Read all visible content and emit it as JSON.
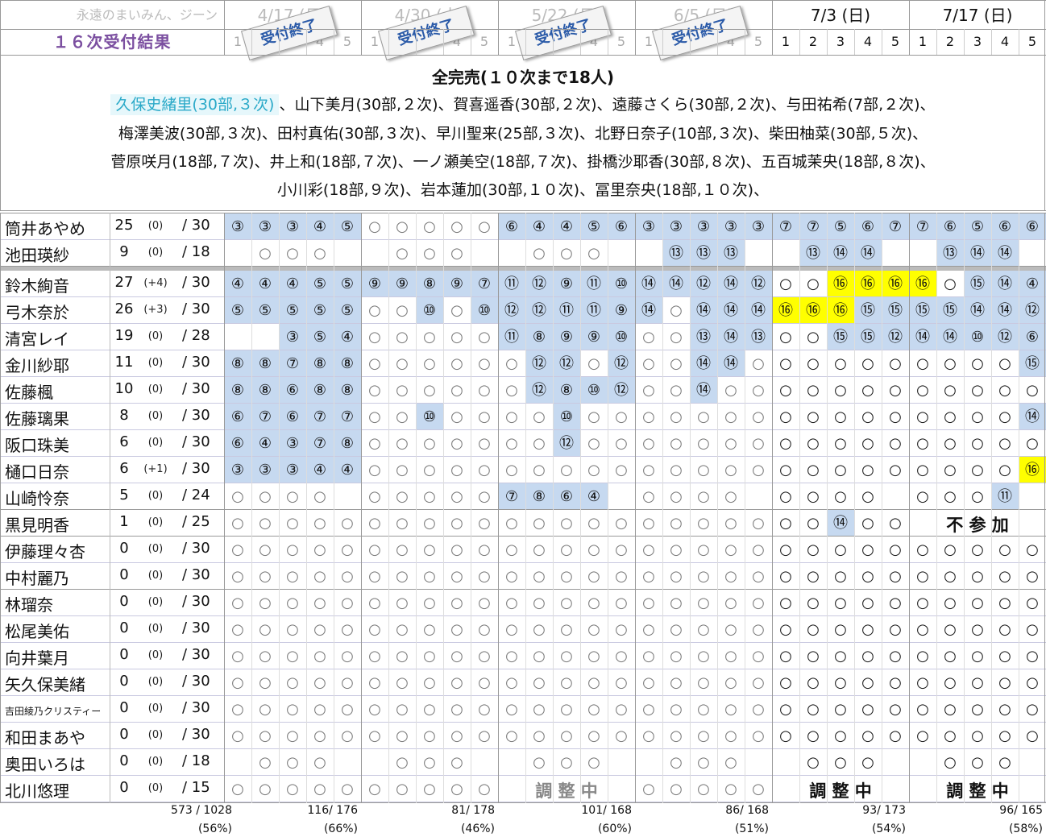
{
  "header": {
    "site_title": "永遠のまいみん、ジーン",
    "result_title": "１６次受付結果",
    "dates": [
      {
        "label": "4/17 (日)",
        "past": true
      },
      {
        "label": "4/30 (土)",
        "past": true
      },
      {
        "label": "5/22 (日)",
        "past": true
      },
      {
        "label": "6/5 (日)",
        "past": true
      },
      {
        "label": "7/3 (日)",
        "past": false
      },
      {
        "label": "7/17 (日)",
        "past": false
      }
    ],
    "slots": [
      "1",
      "2",
      "3",
      "4",
      "5"
    ],
    "closed_stamp": "受付終了"
  },
  "soldout": {
    "title": "全完売(１０次まで18人)",
    "highlight": "久保史緒里(30部,３次)",
    "lines": [
      "、山下美月(30部,２次)、賀喜遥香(30部,２次)、遠藤さくら(30部,２次)、与田祐希(7部,２次)、",
      "梅澤美波(30部,３次)、田村真佑(30部,３次)、早川聖来(25部,３次)、北野日奈子(10部,３次)、柴田柚菜(30部,５次)、",
      "菅原咲月(18部,７次)、井上和(18部,７次)、一ノ瀬美空(18部,７次)、掛橋沙耶香(30部,８次)、五百城茉央(18部,８次)、",
      "小川彩(18部,９次)、岩本蓮加(30部,１０次)、冨里奈央(18部,１０次)、"
    ]
  },
  "members": [
    {
      "name": "筒井あやめ",
      "count": "25",
      "delta": "(0)",
      "total": "/ 30",
      "cells": [
        "b③",
        "b③",
        "b③",
        "b④",
        "b⑤",
        "○",
        "○",
        "○",
        "○",
        "○",
        "b⑥",
        "b④",
        "b④",
        "b⑤",
        "b⑥",
        "b③",
        "b③",
        "b③",
        "b③",
        "b③",
        "b⑦",
        "b⑦",
        "b⑤",
        "b⑥",
        "b⑦",
        "b⑦",
        "b⑥",
        "b⑤",
        "b⑥",
        "b⑥"
      ]
    },
    {
      "name": "池田瑛紗",
      "count": "9",
      "delta": "(0)",
      "total": "/ 18",
      "cells": [
        "",
        "○",
        "○",
        "○",
        "",
        "",
        "○",
        "○",
        "○",
        "",
        "",
        "○",
        "○",
        "○",
        "",
        "",
        "b⑬",
        "b⑬",
        "b⑬",
        "",
        "",
        "b⑬",
        "b⑭",
        "b⑭",
        "",
        "",
        "b⑬",
        "b⑭",
        "b⑭",
        ""
      ]
    },
    {
      "name": "鈴木絢音",
      "count": "27",
      "delta": "(+4)",
      "total": "/ 30",
      "cells": [
        "b④",
        "b④",
        "b④",
        "b⑤",
        "b⑤",
        "b⑨",
        "b⑨",
        "b⑧",
        "b⑨",
        "b⑦",
        "b⑪",
        "b⑫",
        "b⑨",
        "b⑪",
        "b⑩",
        "b⑭",
        "b⑭",
        "b⑫",
        "b⑭",
        "b⑫",
        "○",
        "○",
        "y⑯",
        "y⑯",
        "y⑯",
        "y⑯",
        "○",
        "b⑮",
        "b⑭",
        "b④"
      ]
    },
    {
      "name": "弓木奈於",
      "count": "26",
      "delta": "(+3)",
      "total": "/ 30",
      "cells": [
        "b⑤",
        "b⑤",
        "b⑤",
        "b⑤",
        "b⑤",
        "○",
        "○",
        "b⑩",
        "○",
        "b⑩",
        "b⑫",
        "b⑫",
        "b⑪",
        "b⑪",
        "b⑨",
        "b⑭",
        "○",
        "b⑭",
        "b⑭",
        "b⑭",
        "y⑯",
        "y⑯",
        "y⑯",
        "b⑮",
        "b⑮",
        "b⑮",
        "b⑮",
        "b⑭",
        "b⑭",
        "b⑫"
      ]
    },
    {
      "name": "清宮レイ",
      "count": "19",
      "delta": "(0)",
      "total": "/ 28",
      "cells": [
        "",
        "",
        "b③",
        "b⑤",
        "b④",
        "○",
        "○",
        "○",
        "○",
        "○",
        "b⑪",
        "b⑧",
        "b⑨",
        "b⑨",
        "b⑩",
        "○",
        "○",
        "b⑬",
        "b⑭",
        "b⑬",
        "○",
        "○",
        "b⑮",
        "b⑮",
        "b⑫",
        "b⑭",
        "b⑭",
        "b⑩",
        "b⑫",
        "b⑥"
      ]
    },
    {
      "name": "金川紗耶",
      "count": "11",
      "delta": "(0)",
      "total": "/ 30",
      "cells": [
        "b⑧",
        "b⑧",
        "b⑦",
        "b⑧",
        "b⑧",
        "○",
        "○",
        "○",
        "○",
        "○",
        "○",
        "b⑫",
        "b⑫",
        "○",
        "b⑫",
        "○",
        "○",
        "b⑭",
        "b⑭",
        "○",
        "○",
        "○",
        "○",
        "○",
        "○",
        "○",
        "○",
        "○",
        "○",
        "b⑮"
      ]
    },
    {
      "name": "佐藤楓",
      "count": "10",
      "delta": "(0)",
      "total": "/ 30",
      "cells": [
        "b⑧",
        "b⑧",
        "b⑥",
        "b⑧",
        "b⑧",
        "○",
        "○",
        "○",
        "○",
        "○",
        "○",
        "b⑫",
        "b⑧",
        "b⑩",
        "b⑫",
        "○",
        "○",
        "b⑭",
        "○",
        "○",
        "○",
        "○",
        "○",
        "○",
        "○",
        "○",
        "○",
        "○",
        "○",
        "○"
      ]
    },
    {
      "name": "佐藤璃果",
      "count": "8",
      "delta": "(0)",
      "total": "/ 30",
      "cells": [
        "b⑥",
        "b⑦",
        "b⑥",
        "b⑦",
        "b⑦",
        "○",
        "○",
        "b⑩",
        "○",
        "○",
        "○",
        "○",
        "b⑩",
        "○",
        "○",
        "○",
        "○",
        "○",
        "○",
        "○",
        "○",
        "○",
        "○",
        "○",
        "○",
        "○",
        "○",
        "○",
        "○",
        "b⑭"
      ]
    },
    {
      "name": "阪口珠美",
      "count": "6",
      "delta": "(0)",
      "total": "/ 30",
      "cells": [
        "b⑥",
        "b④",
        "b③",
        "b⑦",
        "b⑧",
        "○",
        "○",
        "○",
        "○",
        "○",
        "○",
        "○",
        "b⑫",
        "○",
        "○",
        "○",
        "○",
        "○",
        "○",
        "○",
        "○",
        "○",
        "○",
        "○",
        "○",
        "○",
        "○",
        "○",
        "○",
        "○"
      ]
    },
    {
      "name": "樋口日奈",
      "count": "6",
      "delta": "(+1)",
      "total": "/ 30",
      "cells": [
        "b③",
        "b③",
        "b③",
        "b④",
        "b④",
        "○",
        "○",
        "○",
        "○",
        "○",
        "○",
        "○",
        "○",
        "○",
        "○",
        "○",
        "○",
        "○",
        "○",
        "○",
        "○",
        "○",
        "○",
        "○",
        "○",
        "○",
        "○",
        "○",
        "○",
        "y⑯"
      ]
    },
    {
      "name": "山崎怜奈",
      "count": "5",
      "delta": "(0)",
      "total": "/ 24",
      "cells": [
        "○",
        "○",
        "○",
        "○",
        "",
        "○",
        "○",
        "○",
        "○",
        "○",
        "b⑦",
        "b⑧",
        "b⑥",
        "b④",
        "",
        "○",
        "○",
        "○",
        "○",
        "",
        "○",
        "○",
        "○",
        "○",
        "",
        "○",
        "○",
        "○",
        "b⑪",
        ""
      ]
    },
    {
      "name": "黒見明香",
      "count": "1",
      "delta": "(0)",
      "total": "/ 25",
      "cells": [
        "○",
        "○",
        "○",
        "○",
        "○",
        "○",
        "○",
        "○",
        "○",
        "○",
        "○",
        "○",
        "○",
        "○",
        "○",
        "○",
        "○",
        "○",
        "○",
        "○",
        "○",
        "○",
        "b⑭",
        "○",
        "○",
        "",
        "",
        "",
        "",
        ""
      ],
      "banner": {
        "text": "不 参 加",
        "start": 25,
        "span": 5,
        "gray": false
      }
    },
    {
      "name": "伊藤理々杏",
      "count": "0",
      "delta": "(0)",
      "total": "/ 30",
      "cells": "all"
    },
    {
      "name": "中村麗乃",
      "count": "0",
      "delta": "(0)",
      "total": "/ 30",
      "cells": "all"
    },
    {
      "name": "林瑠奈",
      "count": "0",
      "delta": "(0)",
      "total": "/ 30",
      "cells": "all"
    },
    {
      "name": "松尾美佑",
      "count": "0",
      "delta": "(0)",
      "total": "/ 30",
      "cells": "all"
    },
    {
      "name": "向井葉月",
      "count": "0",
      "delta": "(0)",
      "total": "/ 30",
      "cells": "all"
    },
    {
      "name": "矢久保美緒",
      "count": "0",
      "delta": "(0)",
      "total": "/ 30",
      "cells": "all"
    },
    {
      "name": "吉田綾乃クリスティー",
      "count": "0",
      "delta": "(0)",
      "total": "/ 30",
      "cells": "all",
      "small": true
    },
    {
      "name": "和田まあや",
      "count": "0",
      "delta": "(0)",
      "total": "/ 30",
      "cells": "all"
    },
    {
      "name": "奥田いろは",
      "count": "0",
      "delta": "(0)",
      "total": "/ 18",
      "cells": [
        "",
        "○",
        "○",
        "○",
        "",
        "",
        "○",
        "○",
        "○",
        "",
        "",
        "○",
        "○",
        "○",
        "",
        "",
        "○",
        "○",
        "○",
        "",
        "",
        "○",
        "○",
        "○",
        "",
        "",
        "○",
        "○",
        "○",
        ""
      ]
    },
    {
      "name": "北川悠理",
      "count": "0",
      "delta": "(0)",
      "total": "/ 15",
      "cells": [
        "○",
        "○",
        "○",
        "○",
        "○",
        "○",
        "○",
        "○",
        "○",
        "○",
        "",
        "",
        "",
        "",
        "",
        "○",
        "○",
        "○",
        "○",
        "○",
        "",
        "",
        "",
        "",
        "",
        "",
        "",
        "",
        "",
        ""
      ],
      "banners": [
        {
          "text": "調 整 中",
          "start": 10,
          "span": 5,
          "gray": true
        },
        {
          "text": "調 整 中",
          "start": 20,
          "span": 5,
          "gray": false
        },
        {
          "text": "調 整 中",
          "start": 25,
          "span": 5,
          "gray": false
        }
      ]
    }
  ],
  "footer": {
    "totals": [
      "573 / 1028",
      "116/ 176",
      "81/ 178",
      "101/ 168",
      "86/ 168",
      "93/ 173",
      "96/ 165"
    ],
    "percents": [
      "(56%)",
      "(66%)",
      "(46%)",
      "(60%)",
      "(51%)",
      "(54%)",
      "(58%)"
    ]
  }
}
